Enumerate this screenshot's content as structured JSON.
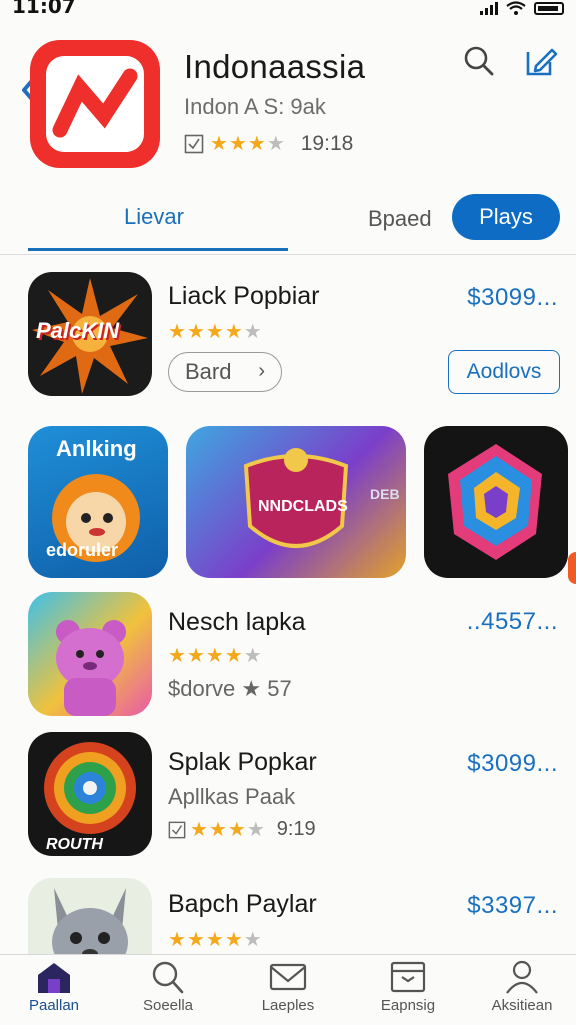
{
  "status": {
    "time": "11:07"
  },
  "app": {
    "title": "Indonaassia",
    "subtitle": "Indon A S: 9ak",
    "rating_value": "19:18"
  },
  "tabs": {
    "active": "Lievar",
    "second": "Bpaed",
    "pill": "Plays"
  },
  "rows": [
    {
      "name": "Liack Popbiar",
      "price": "$3099...",
      "button": "Bard",
      "action": "Aodlovs",
      "stars": 4,
      "thumb_label": "PalcKIN"
    },
    {
      "name": "Nesch lapka",
      "price": "..4557...",
      "sub": "$dorve ★ 57",
      "stars": 4
    },
    {
      "name": "Splak Popkar",
      "price": "$3099...",
      "sub": "Apllkas Paak",
      "rating_value": "9:19",
      "stars": 3,
      "thumb_label": "ROUTH"
    },
    {
      "name": "Bapch Paylar",
      "price": "$3397...",
      "stars": 4
    }
  ],
  "features": [
    {
      "title": "Anlking",
      "label": "edoruler"
    },
    {
      "title": "NNDCLADS",
      "side": "DEB"
    },
    {
      "title": ""
    }
  ],
  "bottom_nav": [
    {
      "label": "Paallan",
      "icon": "home-icon"
    },
    {
      "label": "Soeella",
      "icon": "search-icon"
    },
    {
      "label": "Laeples",
      "icon": "mail-icon"
    },
    {
      "label": "Eapnsig",
      "icon": "tray-icon"
    },
    {
      "label": "Aksitiean",
      "icon": "person-icon"
    }
  ],
  "colors": {
    "accent": "#1a70bf",
    "pill": "#0f6cc4",
    "star": "#f4a81c",
    "brand_red": "#ee2f2b"
  }
}
